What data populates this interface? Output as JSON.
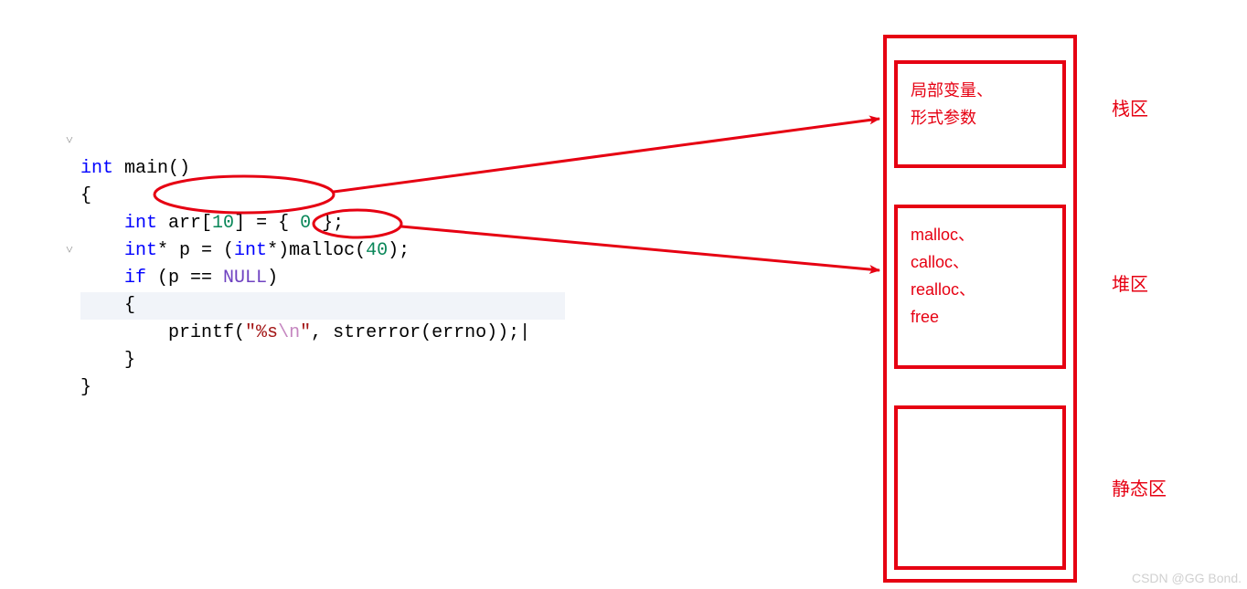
{
  "code": {
    "l1_kw": "int",
    "l1_rest": " main()",
    "l2": "{",
    "l3_indent": "    ",
    "l3_kw": "int",
    "l3_a": " arr[",
    "l3_n10": "10",
    "l3_b": "] = { ",
    "l3_n0": "0",
    "l3_c": " };",
    "l4_indent": "    ",
    "l4_kw1": "int",
    "l4_a": "* p = (",
    "l4_kw2": "int",
    "l4_b": "*)malloc(",
    "l4_n40": "40",
    "l4_c": ");",
    "l5_indent": "    ",
    "l5_kw": "if",
    "l5_a": " (p == ",
    "l5_macro": "NULL",
    "l5_b": ")",
    "l6": "    {",
    "l7_indent": "        ",
    "l7_a": "printf(",
    "l7_str_open": "\"",
    "l7_str_body": "%s",
    "l7_esc": "\\n",
    "l7_str_close": "\"",
    "l7_b": ", strerror(errno));|",
    "l8": "    }",
    "l9": "}"
  },
  "gutter": {
    "chev1": "˅",
    "chev2": "˅"
  },
  "memory": {
    "stack_box": "局部变量、\n形式参数",
    "heap_box": "malloc、\ncalloc、\nrealloc、\nfree",
    "static_box": "",
    "stack_label": "栈区",
    "heap_label": "堆区",
    "static_label": "静态区"
  },
  "colors": {
    "red": "#e60012"
  },
  "watermark": "CSDN @GG Bond."
}
